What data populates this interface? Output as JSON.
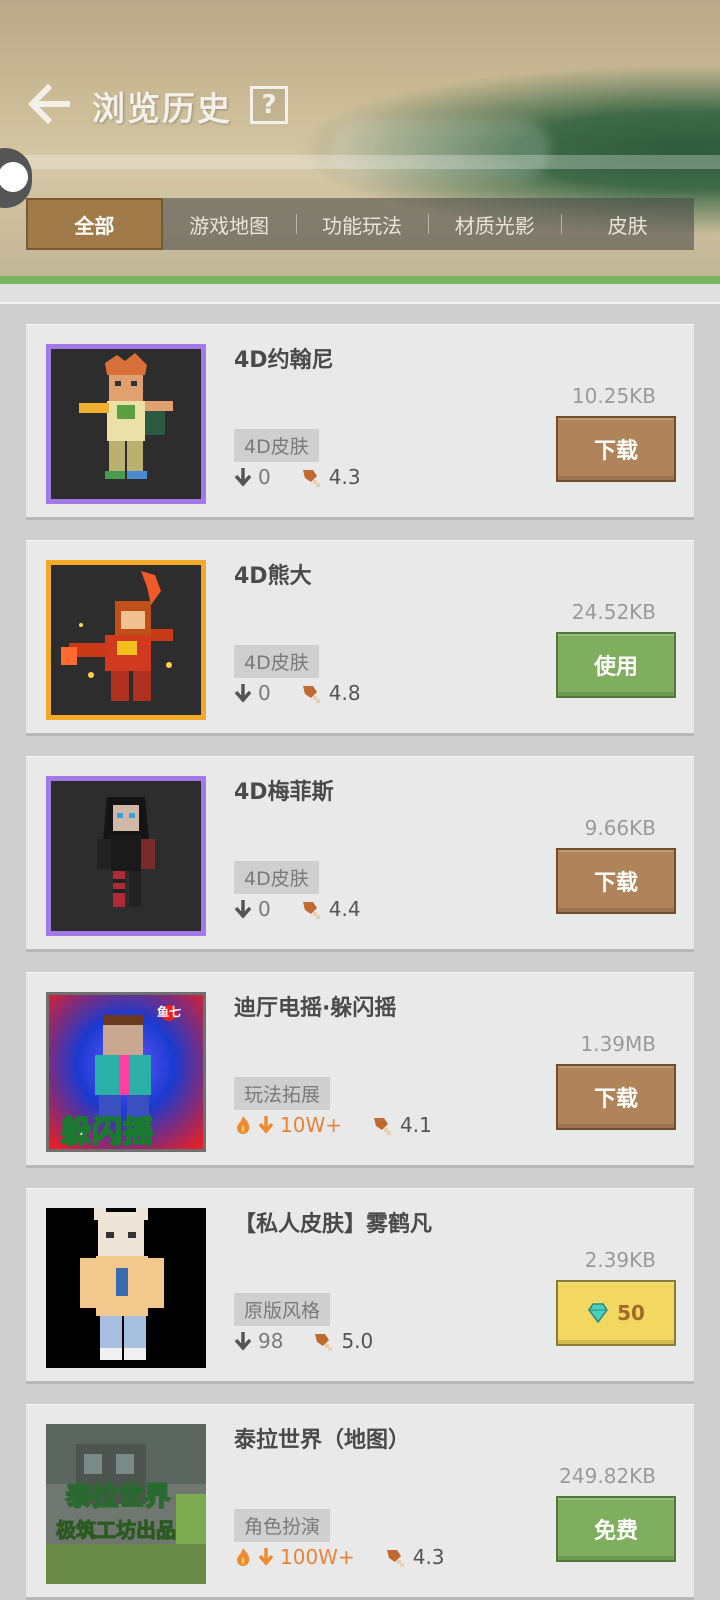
{
  "header": {
    "title": "浏览历史",
    "help_label": "?"
  },
  "tabs": [
    {
      "label": "全部",
      "active": true
    },
    {
      "label": "游戏地图",
      "active": false
    },
    {
      "label": "功能玩法",
      "active": false
    },
    {
      "label": "材质光影",
      "active": false
    },
    {
      "label": "皮肤",
      "active": false
    }
  ],
  "items": [
    {
      "title": "4D约翰尼",
      "size": "10.25KB",
      "tag": "4D皮肤",
      "downloads": "0",
      "rating": "4.3",
      "action": "下载",
      "action_type": "download",
      "frame": "purple"
    },
    {
      "title": "4D熊大",
      "size": "24.52KB",
      "tag": "4D皮肤",
      "downloads": "0",
      "rating": "4.8",
      "action": "使用",
      "action_type": "use",
      "frame": "orange"
    },
    {
      "title": "4D梅菲斯",
      "size": "9.66KB",
      "tag": "4D皮肤",
      "downloads": "0",
      "rating": "4.4",
      "action": "下载",
      "action_type": "download",
      "frame": "purple"
    },
    {
      "title": "迪厅电摇·躲闪摇",
      "size": "1.39MB",
      "tag": "玩法拓展",
      "downloads": "10W+",
      "rating": "4.1",
      "action": "下载",
      "action_type": "download",
      "frame": "grey",
      "hot": true,
      "thumb_text": "躲闪摇",
      "thumb_badge": "鱼七"
    },
    {
      "title": "【私人皮肤】雾鹤凡",
      "size": "2.39KB",
      "tag": "原版风格",
      "downloads": "98",
      "rating": "5.0",
      "action": "50",
      "action_type": "buy",
      "frame": "none"
    },
    {
      "title": "泰拉世界（地图）",
      "size": "249.82KB",
      "tag": "角色扮演",
      "downloads": "100W+",
      "rating": "4.3",
      "action": "免费",
      "action_type": "free",
      "frame": "none",
      "hot": true,
      "thumb_text": "泰拉世界",
      "thumb_text2": "极筑工坊出品"
    }
  ],
  "colors": {
    "download_button": "#b0845a",
    "use_button": "#7faf5e",
    "buy_button": "#f2d760",
    "active_tab": "#a07a48",
    "accent_green": "#79b45e"
  }
}
